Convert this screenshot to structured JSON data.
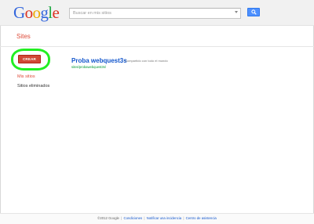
{
  "header": {
    "logo": {
      "letters": [
        "G",
        "o",
        "o",
        "g",
        "l",
        "e"
      ]
    },
    "search": {
      "placeholder": "Buscar en mis sitios",
      "value": ""
    }
  },
  "subheader": {
    "title": "Sites"
  },
  "sidebar": {
    "create_label": "CREAR",
    "items": [
      {
        "label": "Mis sitios",
        "active": true
      },
      {
        "label": "Sitios eliminados",
        "active": false
      }
    ]
  },
  "main": {
    "sites": [
      {
        "title": "Proba webquest3s",
        "meta": "Compartido con todo el mundo",
        "url": "sites/probawebquest3s/"
      }
    ]
  },
  "footer": {
    "copyright": "©2012 Google",
    "links": [
      "Condiciones",
      "Notificar una incidencia",
      "Centro de asistencia"
    ],
    "separator": "|"
  },
  "colors": {
    "accent_red": "#dd4b39",
    "create_button": "#d14836",
    "search_button": "#4d90fe",
    "link_blue": "#1155cc",
    "url_green": "#009933",
    "highlight_ring": "#22ee22"
  }
}
